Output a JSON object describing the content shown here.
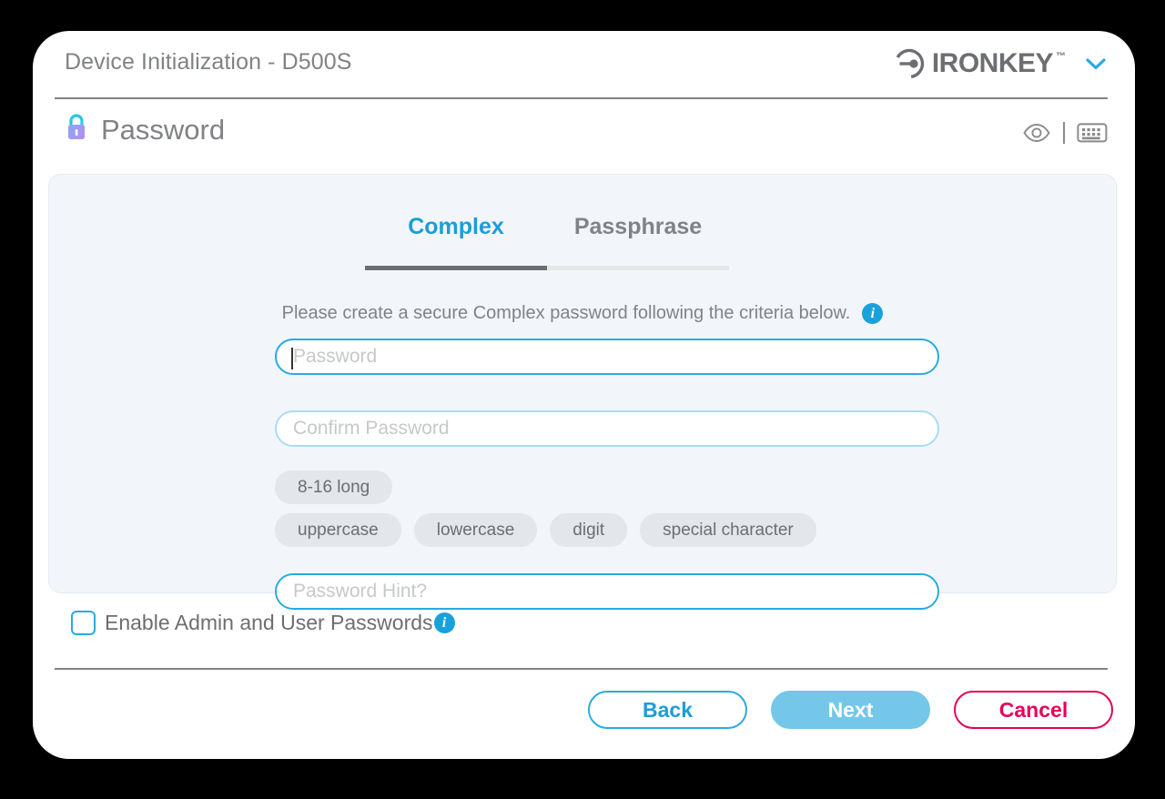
{
  "window": {
    "title": "Device Initialization - D500S",
    "brand_name": "IRONKEY",
    "brand_tm": "™",
    "brand_caret_icon": "chevron-down-icon"
  },
  "section": {
    "icon": "padlock-icon",
    "title": "Password",
    "tools": [
      {
        "name": "eye-icon",
        "label": "Show password"
      },
      {
        "name": "keyboard-icon",
        "label": "Virtual keyboard"
      }
    ]
  },
  "tabs": [
    {
      "label": "Complex",
      "active": true
    },
    {
      "label": "Passphrase",
      "active": false
    }
  ],
  "instruction": {
    "text": "Please create a secure Complex password following the criteria below.",
    "info_icon": "info-icon",
    "info_glyph": "i"
  },
  "fields": {
    "password": {
      "placeholder": "Password",
      "value": "",
      "focused": true
    },
    "confirm": {
      "placeholder": "Confirm Password",
      "value": "",
      "focused": false
    },
    "hint": {
      "placeholder": "Password Hint?",
      "value": "",
      "focused": false
    }
  },
  "criteria": {
    "row1": [
      "8-16 long"
    ],
    "row2": [
      "uppercase",
      "lowercase",
      "digit",
      "special character"
    ]
  },
  "options": {
    "admin_user_passwords": {
      "label": "Enable Admin and User Passwords",
      "checked": false,
      "info_glyph": "i"
    }
  },
  "footer": {
    "back_label": "Back",
    "next_label": "Next",
    "cancel_label": "Cancel"
  },
  "colors": {
    "accent_blue": "#29aae1",
    "tab_active": "#1b9dd9",
    "next_fill": "#74c7e8",
    "cancel_pink": "#e6005a",
    "text_gray": "#6d6e71",
    "panel_bg": "#f2f6fb",
    "chip_bg": "#e3e6ea"
  }
}
